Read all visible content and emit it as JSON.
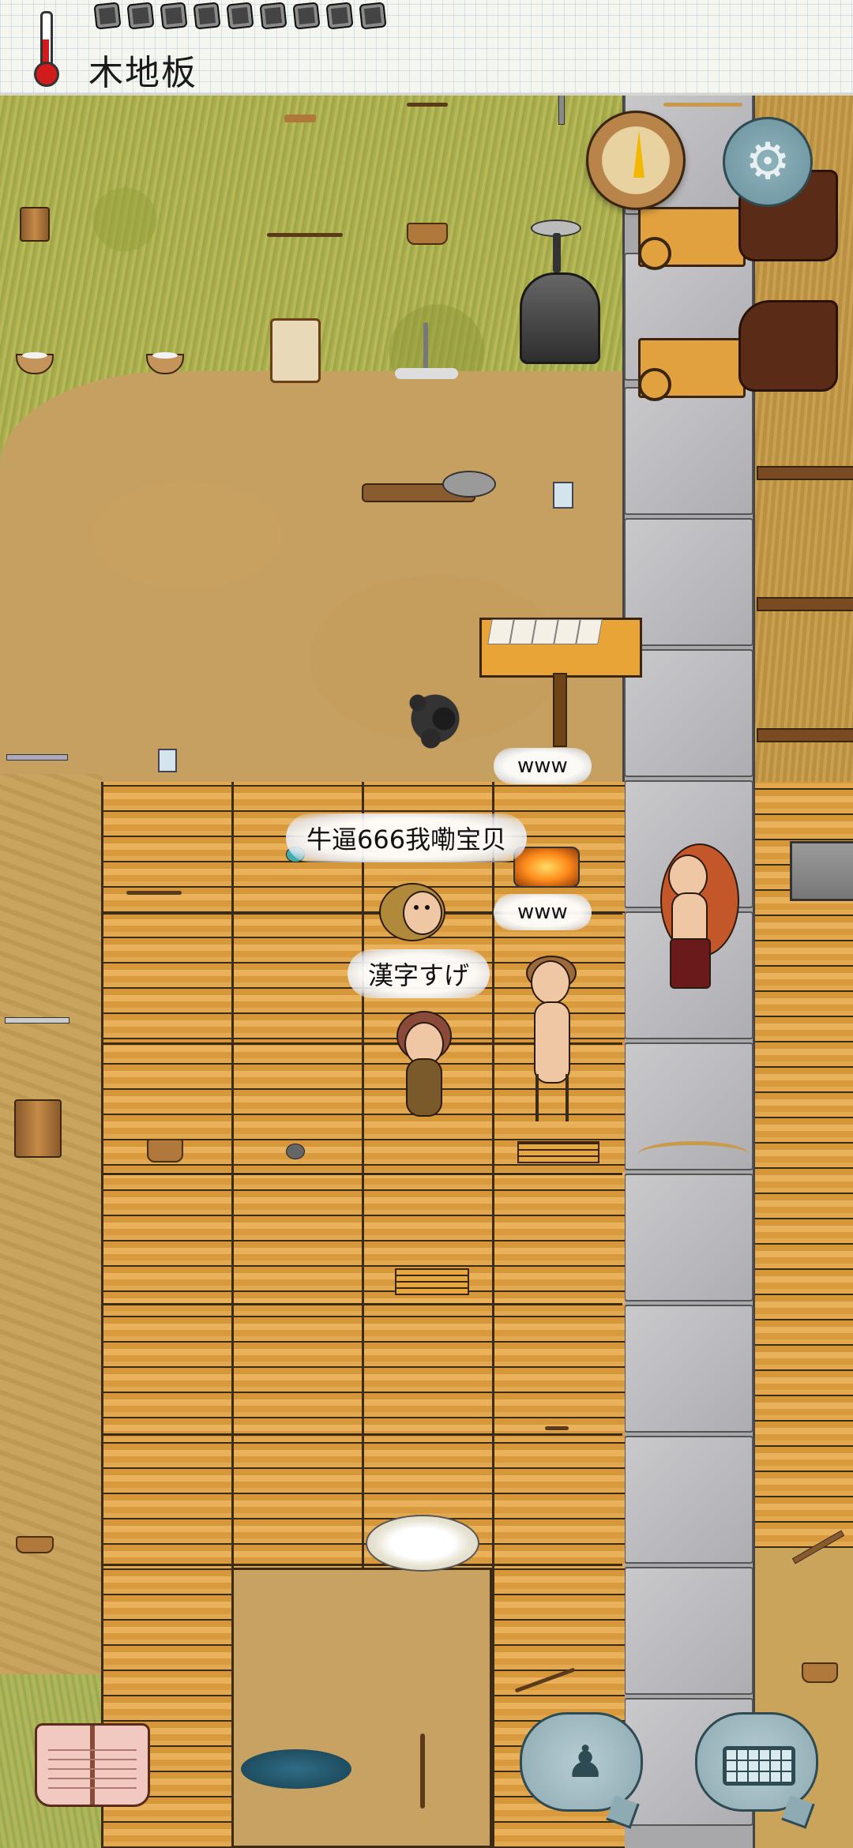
{
  "hud": {
    "location_label": "木地板",
    "thermometer_icon": "thermometer-icon",
    "food_pips_count_label": "",
    "compass_icon": "compass-icon",
    "settings_icon": "gear-icon"
  },
  "bubbles": {
    "b1": "www",
    "b2": "牛逼666我嘞宝贝",
    "b3": "www",
    "b4": "漢字すげ"
  },
  "controls": {
    "book_icon": "book-icon",
    "puppet_icon": "puppet-icon",
    "keyboard_icon": "keyboard-icon"
  },
  "colors": {
    "floor": "#e2a850",
    "road": "#b9b9bd",
    "grass": "#a7ad4f",
    "dirt": "#c6a061"
  }
}
